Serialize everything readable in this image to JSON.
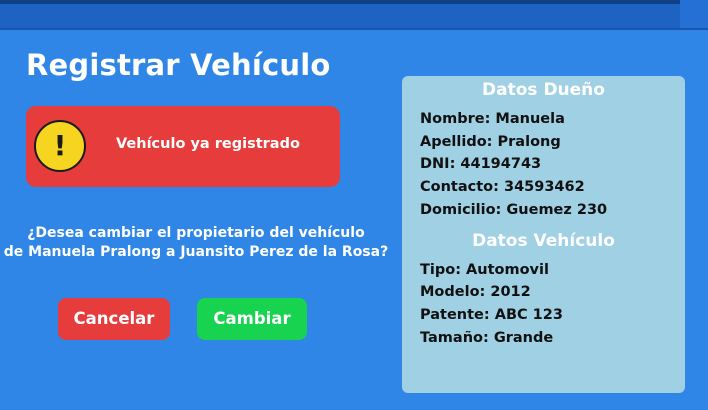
{
  "page": {
    "title": "Registrar Vehículo"
  },
  "alert": {
    "icon": "exclamation-warning-icon",
    "symbol": "!",
    "message": "Vehículo ya registrado"
  },
  "question": {
    "line1": "¿Desea cambiar el propietario del vehículo",
    "line2": "de Manuela Pralong a Juansito Perez de la Rosa?"
  },
  "buttons": {
    "cancel_label": "Cancelar",
    "change_label": "Cambiar"
  },
  "owner": {
    "heading": "Datos Dueño",
    "rows": [
      "Nombre: Manuela",
      "Apellido: Pralong",
      "DNI: 44194743",
      "Contacto: 34593462",
      "Domicilio: Guemez 230"
    ]
  },
  "vehicle": {
    "heading": "Datos Vehículo",
    "rows": [
      "Tipo: Automovil",
      "Modelo: 2012",
      "Patente: ABC 123",
      "Tamaño: Grande"
    ]
  },
  "colors": {
    "background": "#2f86e6",
    "alert": "#e63c3c",
    "warning_icon": "#f5d51f",
    "cancel": "#e63c3c",
    "change": "#18d34f",
    "panel": "#9fd0e3"
  }
}
